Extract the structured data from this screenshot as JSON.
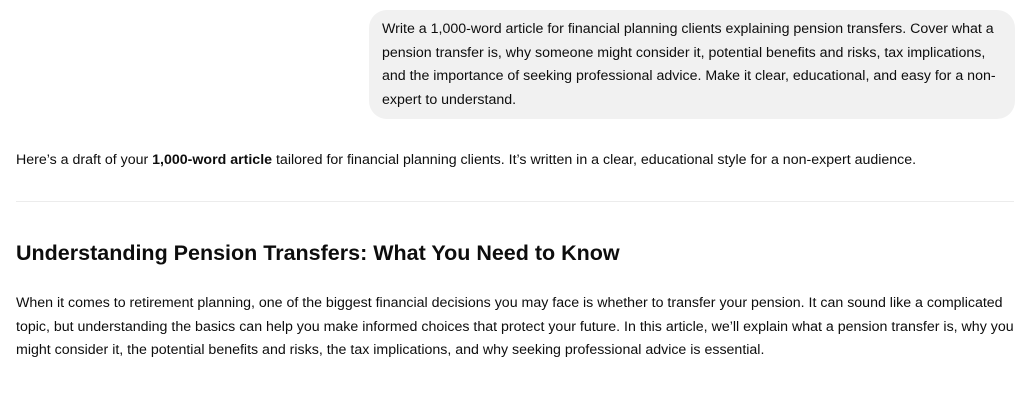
{
  "user_message": {
    "text": "Write a 1,000-word article for financial planning clients explaining pension transfers. Cover what a pension transfer is, why someone might consider it, potential benefits and risks, tax implications, and the importance of seeking professional advice. Make it clear, educational, and easy for a non-expert to understand."
  },
  "assistant_message": {
    "intro_before": "Here’s a draft of your ",
    "intro_bold": "1,000-word article",
    "intro_after": " tailored for financial planning clients. It’s written in a clear, educational style for a non-expert audience.",
    "article_title": "Understanding Pension Transfers: What You Need to Know",
    "paragraph_1": "When it comes to retirement planning, one of the biggest financial decisions you may face is whether to transfer your pension. It can sound like a complicated topic, but understanding the basics can help you make informed choices that protect your future. In this article, we’ll explain what a pension transfer is, why you might consider it, the potential benefits and risks, the tax implications, and why seeking professional advice is essential."
  }
}
